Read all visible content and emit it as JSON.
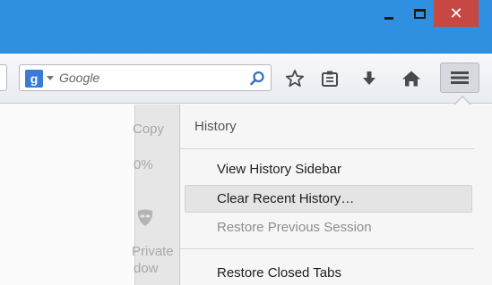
{
  "window": {
    "close_glyph": "✕",
    "colors": {
      "titlebar": "#2f8fe0",
      "close": "#c74843"
    }
  },
  "toolbar": {
    "search": {
      "engine_badge": "g",
      "placeholder": "Google"
    },
    "icons": [
      "star-icon",
      "clipboard-icon",
      "download-icon",
      "home-icon",
      "hamburger-menu-icon"
    ]
  },
  "background_panel": {
    "copy_label": "Copy",
    "zoom_label": "0%",
    "private_line1": "Private",
    "private_line2": "dow"
  },
  "history_panel": {
    "header": "History",
    "items": [
      {
        "label": "View History Sidebar",
        "enabled": true
      },
      {
        "label": "Clear Recent History…",
        "enabled": true,
        "highlighted": true
      },
      {
        "label": "Restore Previous Session",
        "enabled": false
      },
      {
        "label": "Restore Closed Tabs",
        "enabled": true
      }
    ]
  }
}
